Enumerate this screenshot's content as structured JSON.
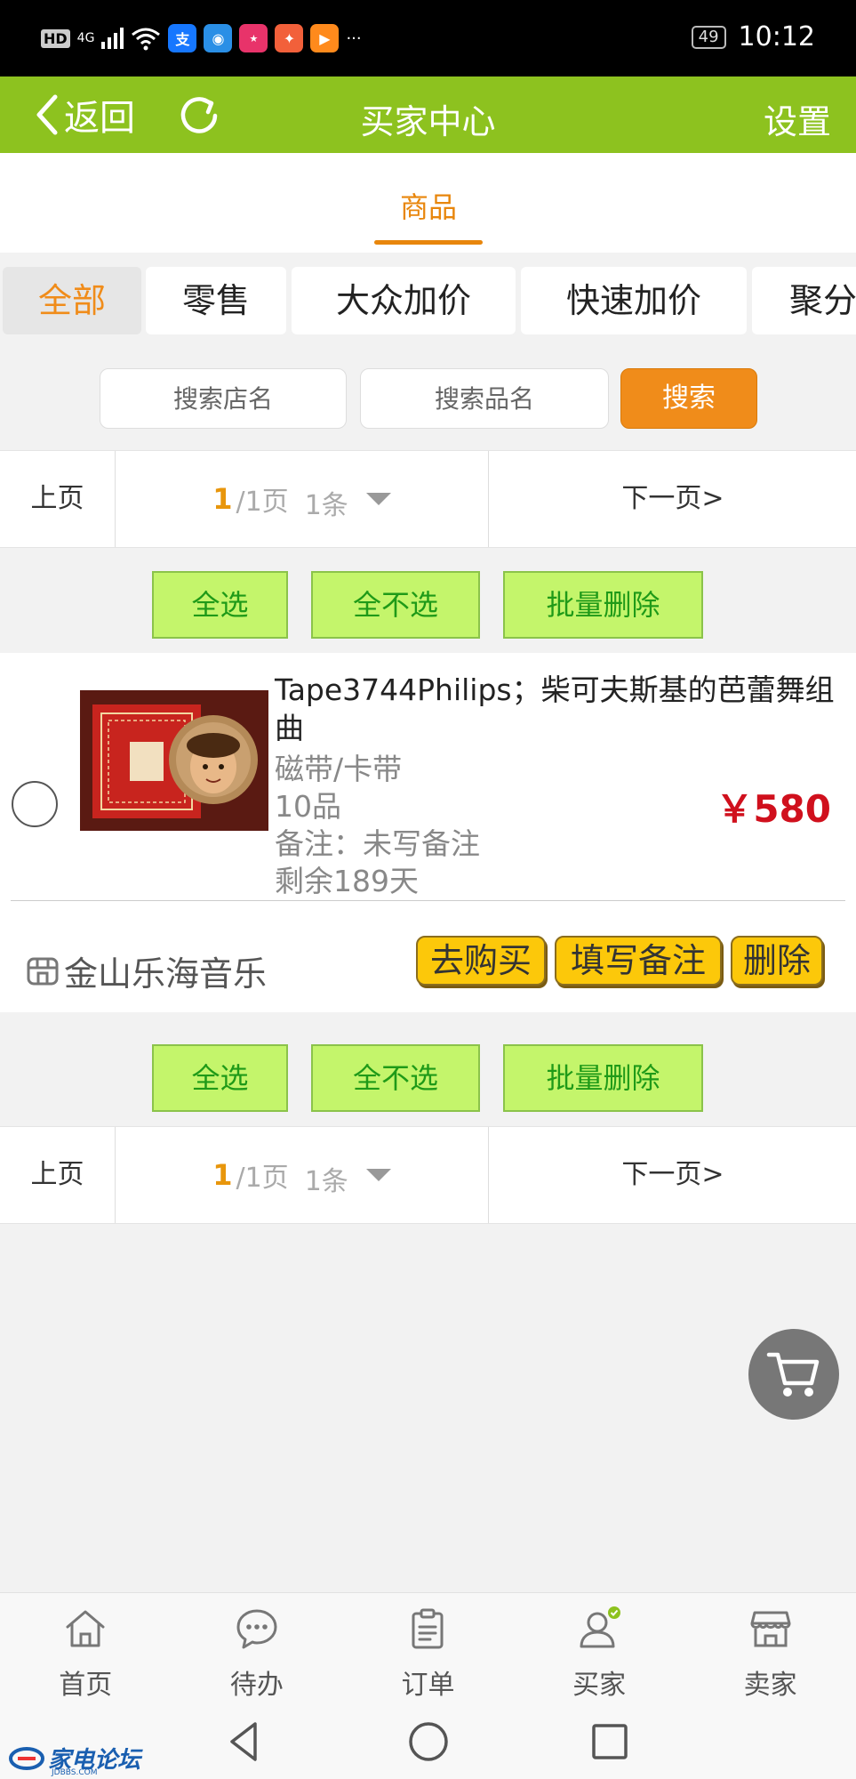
{
  "status_bar": {
    "hd": "HD",
    "network": "4G",
    "more": "···",
    "battery": "49",
    "time": "10:12"
  },
  "header": {
    "back_label": "返回",
    "title": "买家中心",
    "settings_label": "设置"
  },
  "tab": {
    "label": "商品"
  },
  "categories": [
    "全部",
    "零售",
    "大众加价",
    "快速加价",
    "聚分"
  ],
  "search": {
    "shop_placeholder": "搜索店名",
    "item_placeholder": "搜索品名",
    "button_label": "搜索"
  },
  "pager": {
    "prev_label": "上页",
    "current_page": "1",
    "total_pages": "/1页",
    "count": "1条",
    "next_label": "下一页>"
  },
  "bulk": {
    "select_all": "全选",
    "select_none": "全不选",
    "batch_delete": "批量删除"
  },
  "item": {
    "title": "Tape3744Philips；柴可夫斯基的芭蕾舞组曲",
    "category": "磁带/卡带",
    "condition": "10品",
    "note": "备注：未写备注",
    "remaining": "剩余189天",
    "price": "￥580",
    "shop_name": "金山乐海音乐",
    "actions": {
      "buy": "去购买",
      "write_note": "填写备注",
      "delete": "删除"
    }
  },
  "bottom_nav": [
    {
      "label": "首页",
      "icon": "home-icon"
    },
    {
      "label": "待办",
      "icon": "chat-icon"
    },
    {
      "label": "订单",
      "icon": "clipboard-icon"
    },
    {
      "label": "买家",
      "icon": "user-icon"
    },
    {
      "label": "卖家",
      "icon": "store-icon"
    }
  ],
  "watermark": {
    "text": "家电论坛",
    "sub": "JDBBS.COM"
  },
  "colors": {
    "brand_green": "#8dc21f",
    "accent_orange": "#f08c1a",
    "price_red": "#d0101d",
    "bulk_green": "#c4f56b",
    "action_yellow": "#fcc80a"
  }
}
